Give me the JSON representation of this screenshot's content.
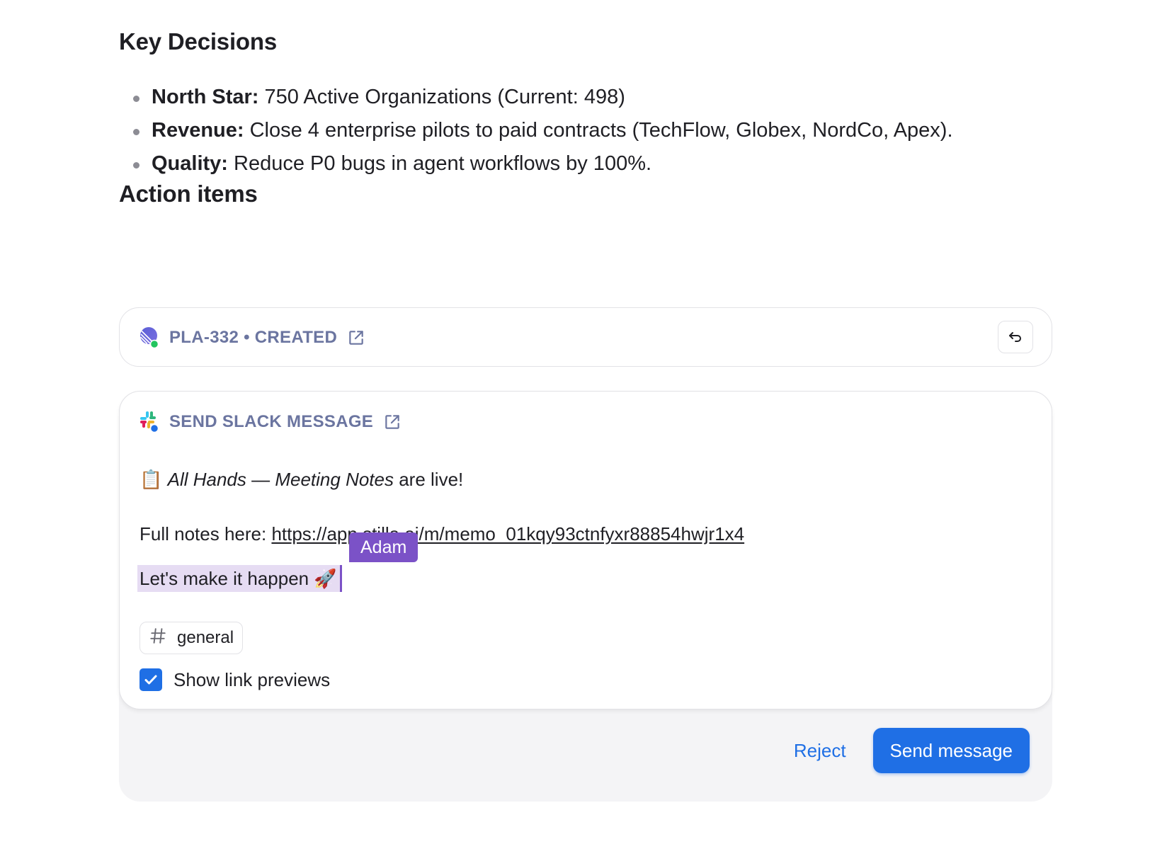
{
  "key_decisions": {
    "title": "Key Decisions",
    "items": [
      {
        "label": "North Star:",
        "text": " 750 Active Organizations (Current: 498)"
      },
      {
        "label": "Revenue:",
        "text": " Close 4 enterprise pilots to paid contracts (TechFlow, Globex, NordCo, Apex)."
      },
      {
        "label": "Quality:",
        "text": " Reduce P0 bugs in agent workflows by 100%."
      }
    ]
  },
  "action_items": {
    "title": "Action items",
    "linear_card": {
      "label": "PLA-332 • CREATED",
      "icon": "linear-icon",
      "status_color": "#22c55e",
      "undo_icon": "undo-icon"
    },
    "slack_card": {
      "label": "SEND SLACK MESSAGE",
      "icon": "slack-icon",
      "message": {
        "line1_emoji": "📋",
        "line1_italic_a": "All Hands",
        "line1_dash": " — ",
        "line1_italic_b": "Meeting Notes",
        "line1_rest": " are live!",
        "line2_prefix": "Full notes here: ",
        "line2_link": "https://app.stilla.ai/m/memo_01kqy93ctnfyxr88854hwjr1x4",
        "line3_text": "Let's make it happen 🚀"
      },
      "presence_user": "Adam",
      "presence_color": "#7b52c7",
      "channel": "general",
      "show_link_previews_label": "Show link previews",
      "show_link_previews_checked": true
    },
    "actions": {
      "reject_label": "Reject",
      "send_label": "Send message",
      "accent_color": "#1f6fe5"
    }
  }
}
